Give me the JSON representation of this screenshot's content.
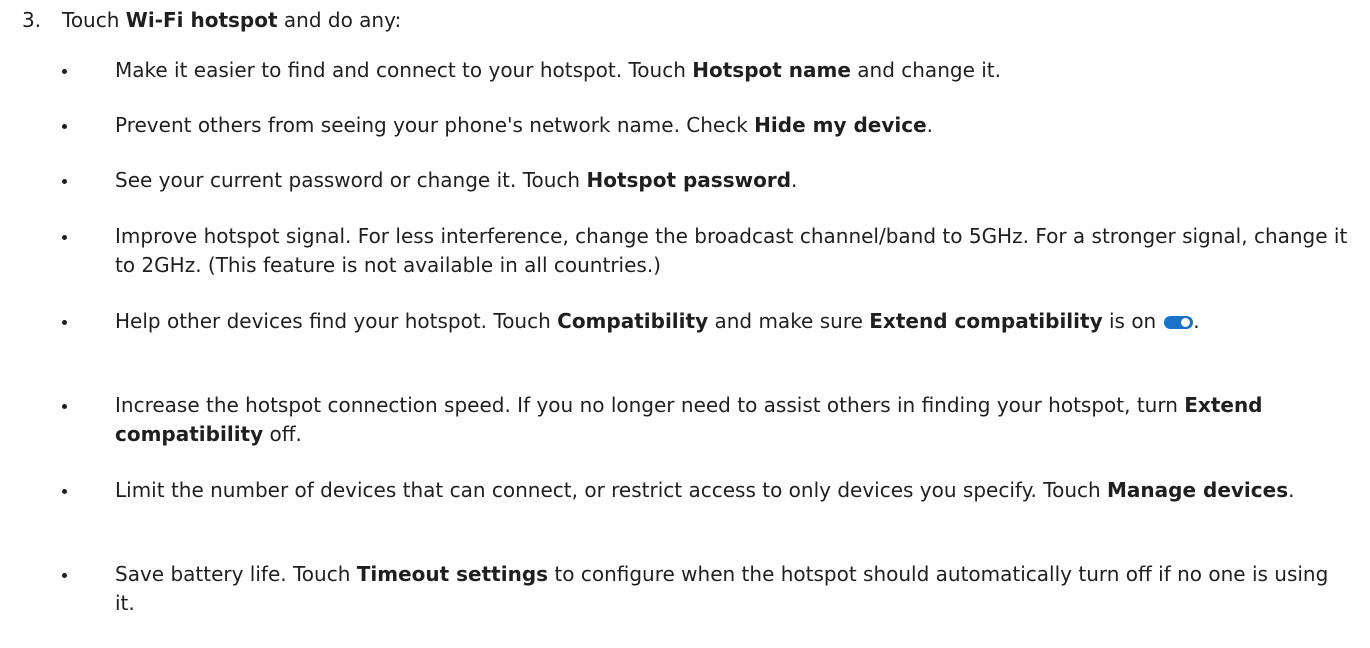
{
  "step": {
    "number": "3.",
    "prefix": "Touch ",
    "bold": "Wi-Fi hotspot",
    "suffix": " and do any:"
  },
  "bullets": [
    {
      "t1": "Make it easier to find and connect to your hotspot. Touch ",
      "b1": "Hotspot name",
      "t2": " and change it."
    },
    {
      "t1": "Prevent others from seeing your phone's network name. Check ",
      "b1": "Hide my device",
      "t2": "."
    },
    {
      "t1": "See your current password or change it. Touch ",
      "b1": "Hotspot password",
      "t2": "."
    },
    {
      "t1": "Improve hotspot signal. For less interference, change the broadcast channel/band to 5GHz. For a stronger signal, change it to 2GHz. (This feature is not available in all countries.)"
    },
    {
      "t1": "Help other devices find your hotspot. Touch ",
      "b1": "Compatibility",
      "t2": " and make sure ",
      "b2": "Extend compatibility",
      "t3": " is on",
      "t4": ".",
      "toggle_icon": "toggle-on-icon",
      "toggle_color": "#1a73c8",
      "toggle_state": "on"
    },
    {
      "t1": "Increase the hotspot connection speed. If you no longer need to assist others in finding your hotspot, turn ",
      "b1": "Extend compatibility",
      "t2": " off."
    },
    {
      "t1": "Limit the number of devices that can connect, or restrict access to only devices you specify. Touch ",
      "b1": "Manage devices",
      "t2": "."
    },
    {
      "t1": "Save battery life. Touch ",
      "b1": "Timeout settings",
      "t2": " to configure when the hotspot should automatically turn off if no one is using it."
    }
  ]
}
